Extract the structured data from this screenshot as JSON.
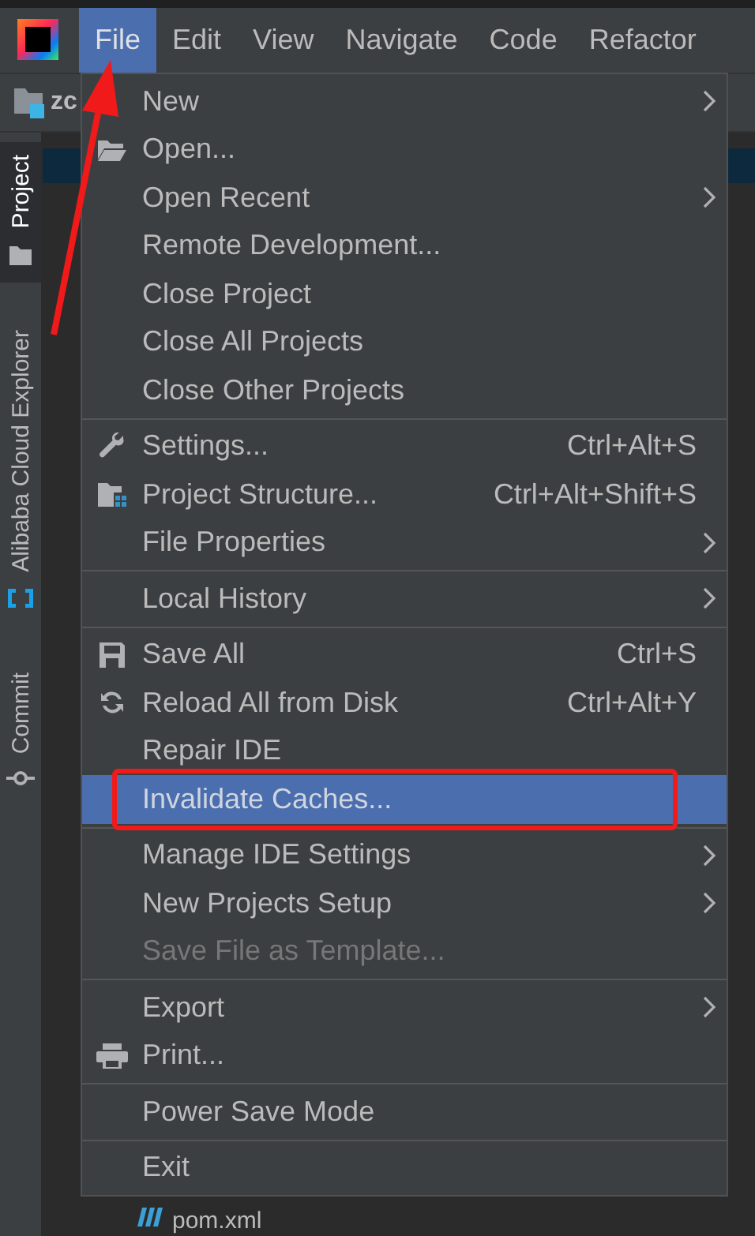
{
  "menubar": {
    "items": [
      {
        "label": "File",
        "selected": true
      },
      {
        "label": "Edit",
        "selected": false
      },
      {
        "label": "View",
        "selected": false
      },
      {
        "label": "Navigate",
        "selected": false
      },
      {
        "label": "Code",
        "selected": false
      },
      {
        "label": "Refactor",
        "selected": false
      }
    ]
  },
  "project_bar": {
    "label": "zc"
  },
  "tool_window_tabs": [
    {
      "label": "Project",
      "selected": true
    },
    {
      "label": "Alibaba Cloud Explorer",
      "selected": false
    },
    {
      "label": "Commit",
      "selected": false
    }
  ],
  "file_item": {
    "label": "pom.xml"
  },
  "annotation_arrow": true,
  "file_menu": [
    {
      "kind": "item",
      "label": "New",
      "submenu": true,
      "selected": false,
      "disabled": false
    },
    {
      "kind": "item",
      "label": "Open...",
      "selected": false,
      "disabled": false
    },
    {
      "kind": "item",
      "label": "Open Recent",
      "submenu": true,
      "selected": false,
      "disabled": false
    },
    {
      "kind": "item",
      "label": "Remote Development...",
      "selected": false,
      "disabled": false
    },
    {
      "kind": "item",
      "label": "Close Project",
      "selected": false,
      "disabled": false
    },
    {
      "kind": "item",
      "label": "Close All Projects",
      "selected": false,
      "disabled": false
    },
    {
      "kind": "item",
      "label": "Close Other Projects",
      "selected": false,
      "disabled": false
    },
    {
      "kind": "separator"
    },
    {
      "kind": "item",
      "label": "Settings...",
      "shortcut": "Ctrl+Alt+S",
      "selected": false,
      "disabled": false
    },
    {
      "kind": "item",
      "label": "Project Structure...",
      "shortcut": "Ctrl+Alt+Shift+S",
      "selected": false,
      "disabled": false
    },
    {
      "kind": "item",
      "label": "File Properties",
      "submenu": true,
      "selected": false,
      "disabled": false
    },
    {
      "kind": "separator"
    },
    {
      "kind": "item",
      "label": "Local History",
      "submenu": true,
      "selected": false,
      "disabled": false
    },
    {
      "kind": "separator"
    },
    {
      "kind": "item",
      "label": "Save All",
      "shortcut": "Ctrl+S",
      "selected": false,
      "disabled": false
    },
    {
      "kind": "item",
      "label": "Reload All from Disk",
      "shortcut": "Ctrl+Alt+Y",
      "selected": false,
      "disabled": false
    },
    {
      "kind": "item",
      "label": "Repair IDE",
      "selected": false,
      "disabled": false
    },
    {
      "kind": "item",
      "label": "Invalidate Caches...",
      "selected": true,
      "disabled": false,
      "outlined": true
    },
    {
      "kind": "separator"
    },
    {
      "kind": "item",
      "label": "Manage IDE Settings",
      "submenu": true,
      "selected": false,
      "disabled": false
    },
    {
      "kind": "item",
      "label": "New Projects Setup",
      "submenu": true,
      "selected": false,
      "disabled": false
    },
    {
      "kind": "item",
      "label": "Save File as Template...",
      "selected": false,
      "disabled": true
    },
    {
      "kind": "separator"
    },
    {
      "kind": "item",
      "label": "Export",
      "submenu": true,
      "selected": false,
      "disabled": false
    },
    {
      "kind": "item",
      "label": "Print...",
      "selected": false,
      "disabled": false
    },
    {
      "kind": "separator"
    },
    {
      "kind": "item",
      "label": "Power Save Mode",
      "selected": false,
      "disabled": false
    },
    {
      "kind": "separator"
    },
    {
      "kind": "item",
      "label": "Exit",
      "selected": false,
      "disabled": false
    }
  ]
}
